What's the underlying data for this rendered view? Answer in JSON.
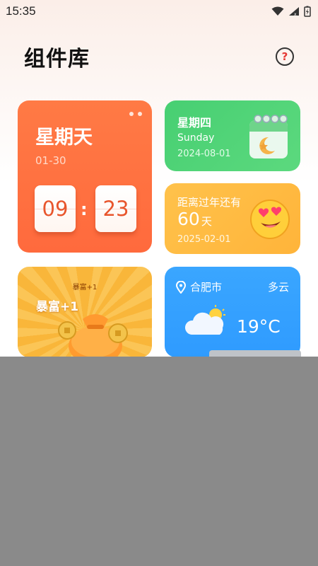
{
  "status_bar": {
    "time": "15:35"
  },
  "header": {
    "title": "组件库",
    "help_symbol": "?"
  },
  "widgets": {
    "clock": {
      "weekday": "星期天",
      "date": "01-30",
      "hour": "09",
      "minute": "23",
      "separator": ":"
    },
    "calendar": {
      "weekday": "星期四",
      "weekday_en": "Sunday",
      "date": "2024-08-01"
    },
    "countdown": {
      "label": "距离过年还有",
      "days": "60",
      "unit": "天",
      "target_date": "2025-02-01"
    },
    "fortune": {
      "small_label": "暴富+1",
      "big_label": "暴富+1"
    },
    "weather": {
      "city": "合肥市",
      "condition": "多云",
      "temperature": "19°C"
    }
  },
  "colors": {
    "clock_card": "#ff6f40",
    "calendar_card": "#4fd376",
    "countdown_card": "#ffbc44",
    "fortune_card": "#fbbd4a",
    "weather_card": "#35a2ff",
    "overlay": "#8a8a8a"
  },
  "icons": [
    "wifi-icon",
    "signal-icon",
    "battery-icon",
    "help-icon",
    "location-pin-icon",
    "calendar-icon",
    "heart-eyes-emoji-icon",
    "money-bag-icon",
    "partly-cloudy-icon"
  ]
}
